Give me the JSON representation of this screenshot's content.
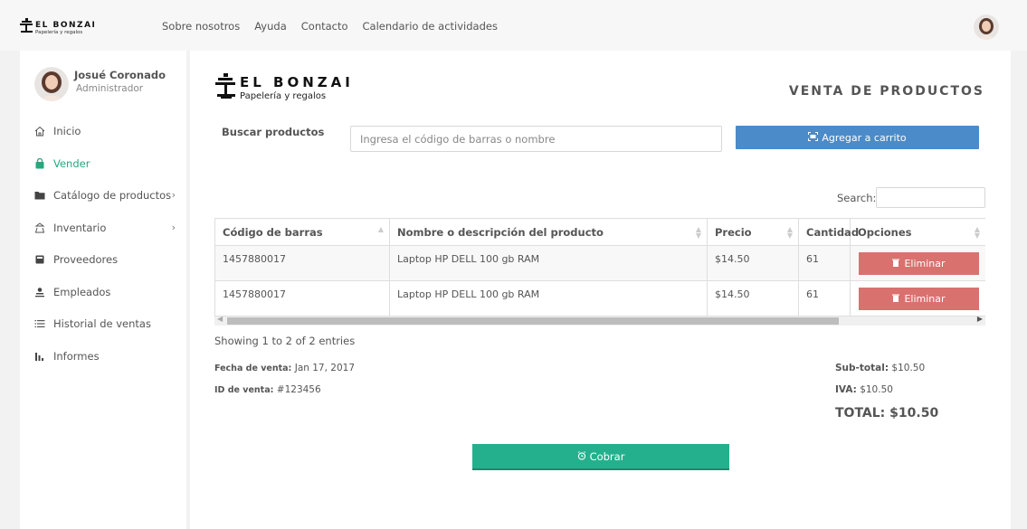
{
  "topnav": {
    "brand_name": "EL BONZAI",
    "brand_tagline": "Papelería y regalos",
    "links": [
      "Sobre nosotros",
      "Ayuda",
      "Contacto",
      "Calendario de actividades"
    ]
  },
  "sidebar": {
    "user_name": "Josué Coronado",
    "user_role": "Administrador",
    "items": [
      {
        "label": "Inicio",
        "icon": "home-icon",
        "active": false
      },
      {
        "label": "Vender",
        "icon": "bag-icon",
        "active": true
      },
      {
        "label": "Catálogo de productos",
        "icon": "folder-icon",
        "chevron": "›"
      },
      {
        "label": "Inventario",
        "icon": "boxes-icon",
        "chevron": "›"
      },
      {
        "label": "Proveedores",
        "icon": "truck-icon"
      },
      {
        "label": "Empleados",
        "icon": "person-icon"
      },
      {
        "label": "Historial de ventas",
        "icon": "list-icon"
      },
      {
        "label": "Informes",
        "icon": "bar-chart-icon"
      }
    ]
  },
  "main": {
    "brand_name": "EL BONZAI",
    "brand_tagline": "Papelería y regalos",
    "title": "VENTA DE PRODUCTOS",
    "search_label": "Buscar productos",
    "search_placeholder": "Ingresa el código de barras o nombre",
    "add_button": "Agregar a carrito",
    "table_search_label": "Search:",
    "columns": [
      "Código de barras",
      "Nombre o descripción del producto",
      "Precio",
      "Cantidad",
      "Opciones"
    ],
    "rows": [
      {
        "barcode": "1457880017",
        "name": "Laptop HP DELL 100 gb RAM",
        "price": "$14.50",
        "qty": "61",
        "action": "Eliminar"
      },
      {
        "barcode": "1457880017",
        "name": "Laptop HP DELL 100 gb RAM",
        "price": "$14.50",
        "qty": "61",
        "action": "Eliminar"
      }
    ],
    "showing": "Showing 1 to 2 of 2 entries",
    "sale_date_label": "Fecha de venta:",
    "sale_date": "Jan 17, 2017",
    "sale_id_label": "ID de venta:",
    "sale_id": "#123456",
    "subtotal_label": "Sub-total:",
    "subtotal": "$10.50",
    "iva_label": "IVA:",
    "iva": "$10.50",
    "total_label": "TOTAL:",
    "total": "$10.50",
    "pay_button": "Cobrar"
  },
  "colors": {
    "accent_green": "#26a77f",
    "primary_blue": "#4b8bc9",
    "danger_red": "#d9716f",
    "pay_green": "#24b08c"
  }
}
